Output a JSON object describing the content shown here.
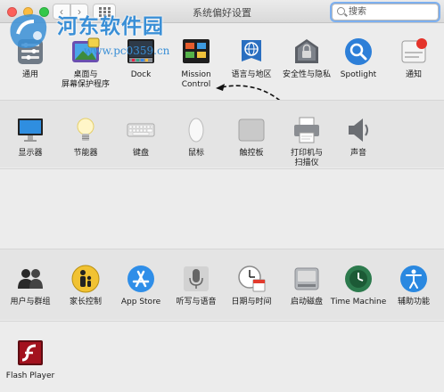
{
  "window": {
    "title": "系统偏好设置",
    "search_placeholder": "搜索"
  },
  "watermark": {
    "title": "河东软件园",
    "url": "www.pc0359.cn"
  },
  "row1": [
    {
      "label": "通用",
      "icon": "general-icon"
    },
    {
      "label": "桌面与\n屏幕保护程序",
      "icon": "desktop-screensaver-icon"
    },
    {
      "label": "Dock",
      "icon": "dock-icon"
    },
    {
      "label": "Mission\nControl",
      "icon": "mission-control-icon"
    },
    {
      "label": "语言与地区",
      "icon": "language-region-icon"
    },
    {
      "label": "安全性与隐私",
      "icon": "security-privacy-icon"
    },
    {
      "label": "Spotlight",
      "icon": "spotlight-icon"
    },
    {
      "label": "通知",
      "icon": "notifications-icon"
    }
  ],
  "row2": [
    {
      "label": "显示器",
      "icon": "displays-icon"
    },
    {
      "label": "节能器",
      "icon": "energy-saver-icon"
    },
    {
      "label": "键盘",
      "icon": "keyboard-icon"
    },
    {
      "label": "鼠标",
      "icon": "mouse-icon"
    },
    {
      "label": "触控板",
      "icon": "trackpad-icon"
    },
    {
      "label": "打印机与\n扫描仪",
      "icon": "printers-scanners-icon"
    },
    {
      "label": "声音",
      "icon": "sound-icon"
    }
  ],
  "row4": [
    {
      "label": "用户与群组",
      "icon": "users-groups-icon"
    },
    {
      "label": "家长控制",
      "icon": "parental-controls-icon"
    },
    {
      "label": "App Store",
      "icon": "app-store-icon"
    },
    {
      "label": "听写与语音",
      "icon": "dictation-speech-icon"
    },
    {
      "label": "日期与时间",
      "icon": "date-time-icon"
    },
    {
      "label": "启动磁盘",
      "icon": "startup-disk-icon"
    },
    {
      "label": "Time Machine",
      "icon": "time-machine-icon"
    },
    {
      "label": "辅助功能",
      "icon": "accessibility-icon"
    }
  ],
  "row5": [
    {
      "label": "Flash Player",
      "icon": "flash-player-icon"
    }
  ],
  "colors": {
    "accent": "#3a8fd6",
    "close": "#fc605b",
    "minimize": "#fdbc40",
    "maximize": "#34c84a"
  }
}
